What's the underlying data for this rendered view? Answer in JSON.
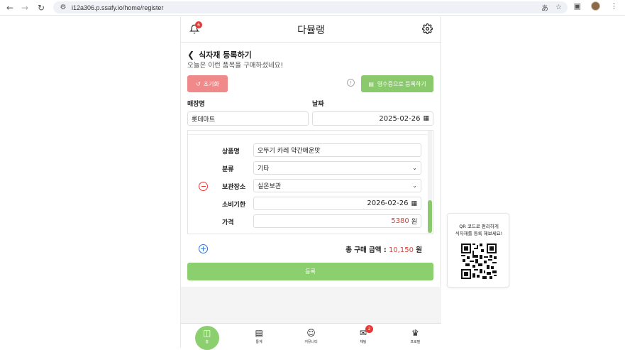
{
  "browser": {
    "url": "i12a306.p.ssafy.io/home/register"
  },
  "header": {
    "title": "다뮬랭",
    "notification_count": "6"
  },
  "page": {
    "title": "식자재 등록하기",
    "subtitle": "오늘은 이런 품목을 구매하셨네요!"
  },
  "actions": {
    "reset_label": "초기화",
    "receipt_label": "영수증으로 등록하기"
  },
  "store": {
    "label": "매장명",
    "value": "롯데마트"
  },
  "date": {
    "label": "날짜",
    "value": "2025-02-26"
  },
  "item": {
    "name_label": "상품명",
    "name_value": "오뚜기 카레 약간매운맛",
    "category_label": "분류",
    "category_value": "기타",
    "storage_label": "보관장소",
    "storage_value": "실온보관",
    "expiry_label": "소비기한",
    "expiry_value": "2026-02-26",
    "price_label": "가격",
    "price_value": "5380",
    "price_unit": "원"
  },
  "total": {
    "label": "총 구매 금액 : ",
    "value": "10,150",
    "unit": "원"
  },
  "submit_label": "등록",
  "nav": {
    "items": [
      {
        "label": "홈",
        "icon": "fridge-icon"
      },
      {
        "label": "통계",
        "icon": "bar-chart-icon"
      },
      {
        "label": "커뮤니티",
        "icon": "community-icon"
      },
      {
        "label": "채팅",
        "icon": "chat-icon",
        "badge": "2"
      },
      {
        "label": "프로필",
        "icon": "chef-icon"
      }
    ]
  },
  "qr": {
    "line1": "QR 코드로 편리하게",
    "line2": "식자재를 등록 해보세요!"
  },
  "colors": {
    "accent_green": "#8bcf6e",
    "reset_red": "#f08a8a",
    "price_red": "#e53935",
    "add_blue": "#2f6fd6"
  }
}
